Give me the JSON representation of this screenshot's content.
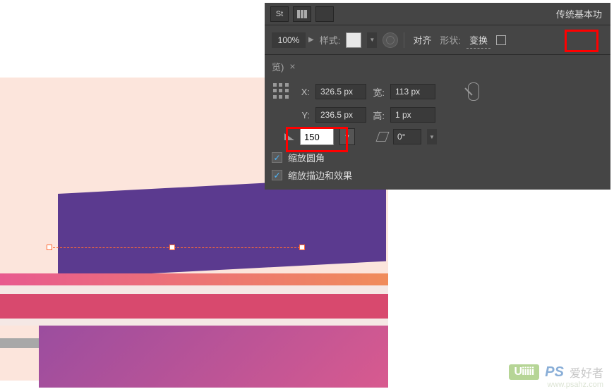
{
  "topbar": {
    "workspace": "传统基本功",
    "st_icon": "St"
  },
  "options": {
    "zoom": "100%",
    "style_label": "样式:",
    "align_label": "对齐",
    "shape_label": "形状:",
    "transform_label": "变换"
  },
  "tab": {
    "name": "览)"
  },
  "transform": {
    "x_label": "X:",
    "x_value": "326.5 px",
    "y_label": "Y:",
    "y_value": "236.5 px",
    "w_label": "宽:",
    "w_value": "113 px",
    "h_label": "高:",
    "h_value": "1 px",
    "rotate_value": "150",
    "skew_value": "0°",
    "scale_corners": "缩放圆角",
    "scale_strokes": "缩放描边和效果"
  },
  "watermark": {
    "green": "Uiiiii",
    "ps": "PS",
    "cn": "爱好者",
    "url": "www.psahz.com"
  }
}
